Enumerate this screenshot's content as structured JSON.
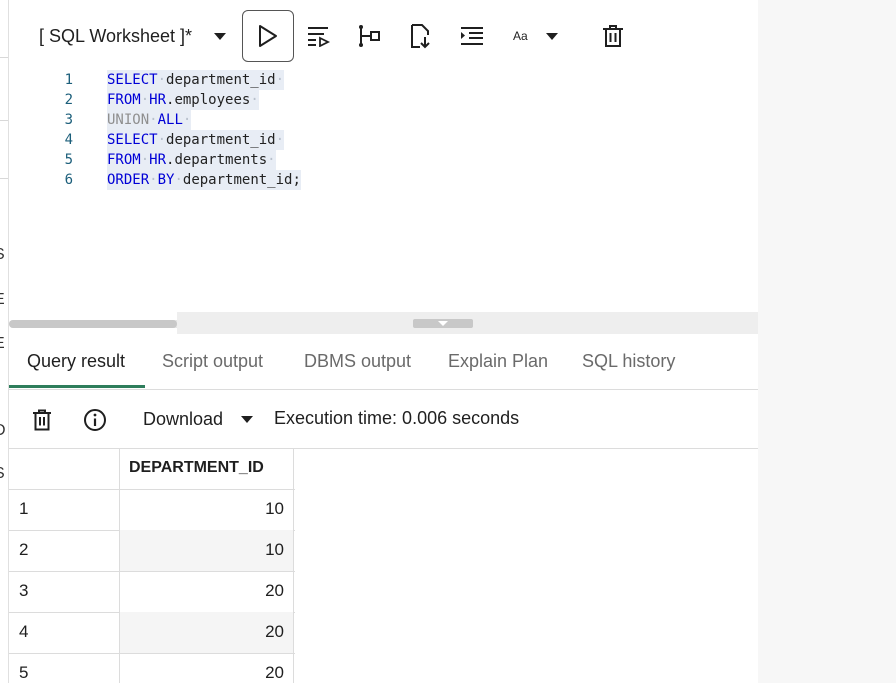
{
  "worksheet": {
    "title": "[ SQL Worksheet ]*"
  },
  "toolbar": {
    "run": "run-icon",
    "run_script": "run-script-icon",
    "explain": "explain-plan-icon",
    "autotrace": "autotrace-icon",
    "format": "format-icon",
    "font_label": "Aa",
    "clear": "trash-icon"
  },
  "editor": {
    "lines": [
      {
        "num": "1",
        "kw": "SELECT",
        "rest": "department_id"
      },
      {
        "num": "2",
        "kw": "FROM",
        "kw2": "HR",
        "rest": ".employees"
      },
      {
        "num": "3",
        "kw": "UNION",
        "kw2": "ALL"
      },
      {
        "num": "4",
        "kw": "SELECT",
        "rest": "department_id"
      },
      {
        "num": "5",
        "kw": "FROM",
        "kw2": "HR",
        "rest": ".departments"
      },
      {
        "num": "6",
        "kw": "ORDER",
        "kw2": "BY",
        "rest": "department_id;"
      }
    ]
  },
  "left_fragments": [
    ")",
    "S",
    "E",
    "E",
    "D",
    "S"
  ],
  "tabs": [
    {
      "label": "Query result"
    },
    {
      "label": "Script output"
    },
    {
      "label": "DBMS output"
    },
    {
      "label": "Explain Plan"
    },
    {
      "label": "SQL history"
    }
  ],
  "results": {
    "download_label": "Download",
    "exec_time": "Execution time: 0.006 seconds",
    "column": "DEPARTMENT_ID",
    "rows": [
      {
        "num": "1",
        "value": "10"
      },
      {
        "num": "2",
        "value": "10"
      },
      {
        "num": "3",
        "value": "20"
      },
      {
        "num": "4",
        "value": "20"
      },
      {
        "num": "5",
        "value": "20"
      }
    ]
  },
  "colors": {
    "accent": "#2e7d5b",
    "keyword": "#0000d6",
    "line_number": "#1b5e7a"
  }
}
